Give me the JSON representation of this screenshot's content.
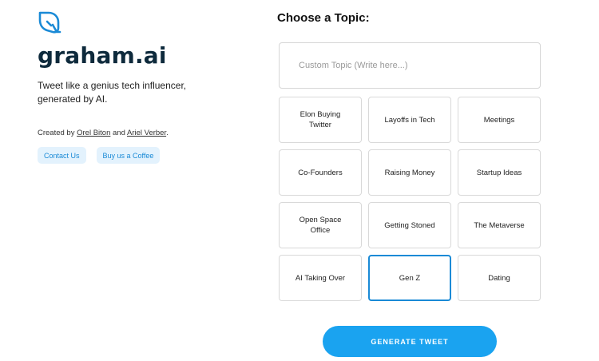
{
  "brand": {
    "name": "graham.ai",
    "tagline": "Tweet like a genius tech influencer, generated by AI.",
    "icon": "bird-logo-icon",
    "accent_color": "#1a8ad6"
  },
  "credits": {
    "prefix": "Created by ",
    "author1": "Orel Biton",
    "joiner": " and ",
    "author2": "Ariel Verber",
    "suffix": "."
  },
  "buttons": {
    "contact": "Contact Us",
    "coffee": "Buy us a Coffee",
    "generate": "GENERATE TWEET"
  },
  "topics": {
    "heading": "Choose a Topic:",
    "custom_placeholder": "Custom Topic (Write here...)",
    "custom_value": "",
    "items": [
      {
        "label": "Elon Buying Twitter",
        "selected": false
      },
      {
        "label": "Layoffs in Tech",
        "selected": false
      },
      {
        "label": "Meetings",
        "selected": false
      },
      {
        "label": "Co-Founders",
        "selected": false
      },
      {
        "label": "Raising Money",
        "selected": false
      },
      {
        "label": "Startup Ideas",
        "selected": false
      },
      {
        "label": "Open Space Office",
        "selected": false
      },
      {
        "label": "Getting Stoned",
        "selected": false
      },
      {
        "label": "The Metaverse",
        "selected": false
      },
      {
        "label": "AI Taking Over",
        "selected": false
      },
      {
        "label": "Gen Z",
        "selected": true
      },
      {
        "label": "Dating",
        "selected": false
      }
    ]
  }
}
